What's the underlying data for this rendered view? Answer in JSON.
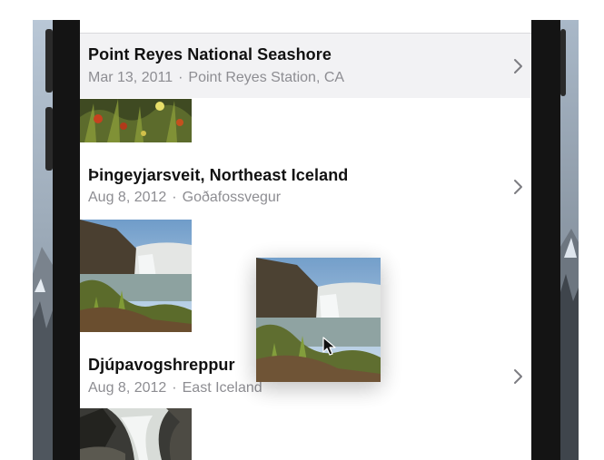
{
  "moments": [
    {
      "title": "Point Reyes National Seashore",
      "date": "Mar 13, 2011",
      "location": "Point Reyes Station, CA",
      "separator": "·",
      "chevron_icon": "chevron-right-icon",
      "selected": true
    },
    {
      "title": "Þingeyjarsveit, Northeast Iceland",
      "date": "Aug 8, 2012",
      "location": "Goðafossvegur",
      "separator": "·",
      "chevron_icon": "chevron-right-icon",
      "selected": false
    },
    {
      "title": "Djúpavogshreppur",
      "date": "Aug 8, 2012",
      "location": "East Iceland",
      "separator": "·",
      "chevron_icon": "chevron-right-icon",
      "selected": false
    }
  ],
  "thumbnails": [
    {
      "subject": "wildflowers-photo"
    },
    {
      "subject": "waterfall-photo"
    },
    {
      "subject": "rocky-waterfall-photo"
    }
  ],
  "drag_photo": {
    "subject": "waterfall-photo",
    "state": "dragging"
  },
  "cursor": {
    "icon": "arrow-cursor-icon"
  },
  "colors": {
    "title_text": "#111111",
    "subtitle_text": "#8d8d92",
    "selected_row": "#f2f2f4",
    "bezel": "#141414"
  }
}
